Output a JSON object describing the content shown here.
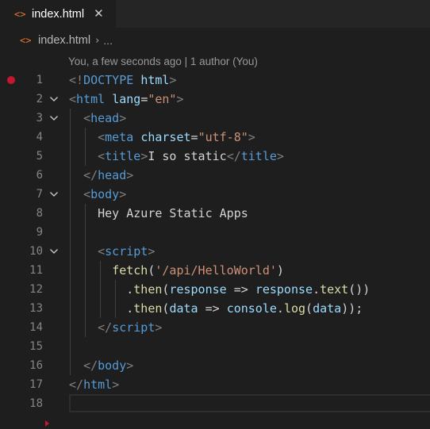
{
  "tab": {
    "icon": "html-file-icon",
    "glyph": "<>",
    "filename": "index.html",
    "close": "✕"
  },
  "breadcrumb": {
    "glyph": "<>",
    "file": "index.html",
    "sep": "›",
    "more": "..."
  },
  "codelens": "You, a few seconds ago | 1 author (You)",
  "colors": {
    "tag_bracket": "#808080",
    "tag": "#569cd6",
    "attr": "#9cdcfe",
    "string": "#ce9178",
    "text": "#d4d4d4",
    "func": "#dcdcaa",
    "breakpoint": "#c5172e",
    "file_icon": "#e37933"
  },
  "editor": {
    "lines": [
      {
        "n": "1",
        "fold": false,
        "breakpoint": true,
        "indent": 0,
        "tokens": [
          [
            "<!",
            "tb"
          ],
          [
            "DOCTYPE",
            "tg"
          ],
          [
            " ",
            "tx"
          ],
          [
            "html",
            "at"
          ],
          [
            ">",
            "tb"
          ]
        ]
      },
      {
        "n": "2",
        "fold": true,
        "indent": 0,
        "tokens": [
          [
            "<",
            "tb"
          ],
          [
            "html",
            "tg"
          ],
          [
            " ",
            "tx"
          ],
          [
            "lang",
            "at"
          ],
          [
            "=",
            "tx"
          ],
          [
            "\"en\"",
            "st"
          ],
          [
            ">",
            "tb"
          ]
        ]
      },
      {
        "n": "3",
        "fold": true,
        "indent": 1,
        "tokens": [
          [
            "  ",
            "tx"
          ],
          [
            "<",
            "tb"
          ],
          [
            "head",
            "tg"
          ],
          [
            ">",
            "tb"
          ]
        ]
      },
      {
        "n": "4",
        "fold": false,
        "indent": 2,
        "tokens": [
          [
            "    ",
            "tx"
          ],
          [
            "<",
            "tb"
          ],
          [
            "meta",
            "tg"
          ],
          [
            " ",
            "tx"
          ],
          [
            "charset",
            "at"
          ],
          [
            "=",
            "tx"
          ],
          [
            "\"utf-8\"",
            "st"
          ],
          [
            ">",
            "tb"
          ]
        ]
      },
      {
        "n": "5",
        "fold": false,
        "indent": 2,
        "tokens": [
          [
            "    ",
            "tx"
          ],
          [
            "<",
            "tb"
          ],
          [
            "title",
            "tg"
          ],
          [
            ">",
            "tb"
          ],
          [
            "I so static",
            "tx"
          ],
          [
            "</",
            "tb"
          ],
          [
            "title",
            "tg"
          ],
          [
            ">",
            "tb"
          ]
        ]
      },
      {
        "n": "6",
        "fold": false,
        "indent": 1,
        "tokens": [
          [
            "  ",
            "tx"
          ],
          [
            "</",
            "tb"
          ],
          [
            "head",
            "tg"
          ],
          [
            ">",
            "tb"
          ]
        ]
      },
      {
        "n": "7",
        "fold": true,
        "indent": 1,
        "tokens": [
          [
            "  ",
            "tx"
          ],
          [
            "<",
            "tb"
          ],
          [
            "body",
            "tg"
          ],
          [
            ">",
            "tb"
          ]
        ]
      },
      {
        "n": "8",
        "fold": false,
        "indent": 2,
        "tokens": [
          [
            "    Hey Azure Static Apps",
            "tx"
          ]
        ]
      },
      {
        "n": "9",
        "fold": false,
        "indent": 2,
        "tokens": []
      },
      {
        "n": "10",
        "fold": true,
        "indent": 2,
        "tokens": [
          [
            "    ",
            "tx"
          ],
          [
            "<",
            "tb"
          ],
          [
            "script",
            "tg"
          ],
          [
            ">",
            "tb"
          ]
        ]
      },
      {
        "n": "11",
        "fold": false,
        "indent": 3,
        "tokens": [
          [
            "      ",
            "tx"
          ],
          [
            "fetch",
            "fn"
          ],
          [
            "(",
            "tx"
          ],
          [
            "'/api/HelloWorld'",
            "st"
          ],
          [
            ")",
            "tx"
          ]
        ]
      },
      {
        "n": "12",
        "fold": false,
        "indent": 4,
        "tokens": [
          [
            "        .",
            "tx"
          ],
          [
            "then",
            "fn"
          ],
          [
            "(",
            "tx"
          ],
          [
            "response",
            "at"
          ],
          [
            " => ",
            "tx"
          ],
          [
            "response",
            "at"
          ],
          [
            ".",
            "tx"
          ],
          [
            "text",
            "fn"
          ],
          [
            "())",
            "tx"
          ]
        ]
      },
      {
        "n": "13",
        "fold": false,
        "indent": 4,
        "tokens": [
          [
            "        .",
            "tx"
          ],
          [
            "then",
            "fn"
          ],
          [
            "(",
            "tx"
          ],
          [
            "data",
            "at"
          ],
          [
            " => ",
            "tx"
          ],
          [
            "console",
            "at"
          ],
          [
            ".",
            "tx"
          ],
          [
            "log",
            "fn"
          ],
          [
            "(",
            "tx"
          ],
          [
            "data",
            "at"
          ],
          [
            "));",
            "tx"
          ]
        ]
      },
      {
        "n": "14",
        "fold": false,
        "indent": 2,
        "tokens": [
          [
            "    ",
            "tx"
          ],
          [
            "</",
            "tb"
          ],
          [
            "script",
            "tg"
          ],
          [
            ">",
            "tb"
          ]
        ]
      },
      {
        "n": "15",
        "fold": false,
        "indent": 2,
        "tokens": []
      },
      {
        "n": "16",
        "fold": false,
        "indent": 1,
        "tokens": [
          [
            "  ",
            "tx"
          ],
          [
            "</",
            "tb"
          ],
          [
            "body",
            "tg"
          ],
          [
            ">",
            "tb"
          ]
        ]
      },
      {
        "n": "17",
        "fold": false,
        "indent": 0,
        "tokens": [
          [
            "</",
            "tb"
          ],
          [
            "html",
            "tg"
          ],
          [
            ">",
            "tb"
          ]
        ]
      },
      {
        "n": "18",
        "fold": false,
        "indent": 0,
        "tokens": []
      }
    ]
  }
}
